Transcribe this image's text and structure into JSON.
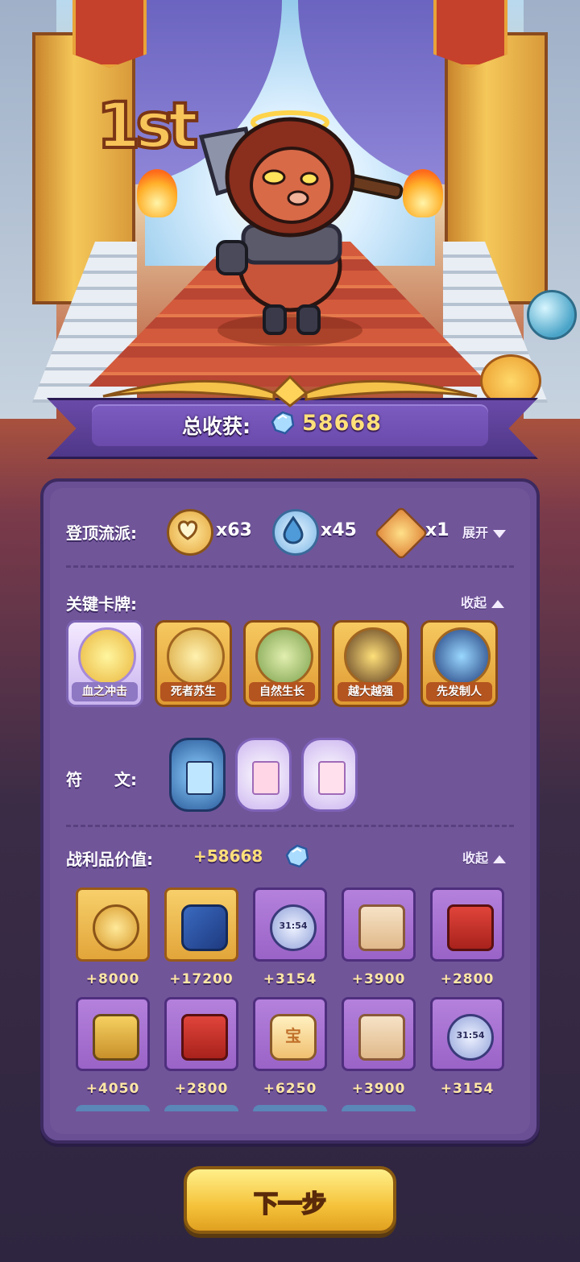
{
  "scene": {
    "rank": "1st"
  },
  "total": {
    "label": "总收获:",
    "value": "58668"
  },
  "build": {
    "title": "登顶流派:",
    "factions": [
      {
        "icon": "heart-coin-icon",
        "count": "x63"
      },
      {
        "icon": "water-drop-icon",
        "count": "x45"
      },
      {
        "icon": "fire-swirl-icon",
        "count": "x1"
      }
    ],
    "toggle": "展开"
  },
  "cards": {
    "title": "关键卡牌:",
    "toggle": "收起",
    "items": [
      {
        "label": "血之冲击",
        "icon": "bleeding-heart-icon"
      },
      {
        "label": "死者苏生",
        "icon": "winged-heart-icon"
      },
      {
        "label": "自然生长",
        "icon": "vine-icon"
      },
      {
        "label": "越大越强",
        "icon": "bull-icon"
      },
      {
        "label": "先发制人",
        "icon": "spirit-beast-icon"
      }
    ]
  },
  "runes": {
    "title": "符　　文:"
  },
  "loot": {
    "title": "战利品价值:",
    "value": "+58668",
    "toggle": "收起",
    "items": [
      {
        "value": "+8000",
        "icon": "clover-coin-icon"
      },
      {
        "value": "+17200",
        "icon": "cannon-icon"
      },
      {
        "value": "+3154",
        "icon": "stopwatch-icon",
        "time": "31:54"
      },
      {
        "value": "+3900",
        "icon": "gift-envelope-icon"
      },
      {
        "value": "+2800",
        "icon": "red-book-icon"
      },
      {
        "value": "+4050",
        "icon": "chained-lock-icon"
      },
      {
        "value": "+2800",
        "icon": "red-book-icon"
      },
      {
        "value": "+6250",
        "icon": "treasure-cake-icon",
        "glyph": "宝"
      },
      {
        "value": "+3900",
        "icon": "gift-envelope-icon"
      },
      {
        "value": "+3154",
        "icon": "stopwatch-icon",
        "time": "31:54"
      }
    ]
  },
  "next_button": {
    "label": "下一步"
  },
  "colors": {
    "panel": "#6a4f95",
    "gold_text": "#ffe07a",
    "button": "#f5c23a"
  }
}
